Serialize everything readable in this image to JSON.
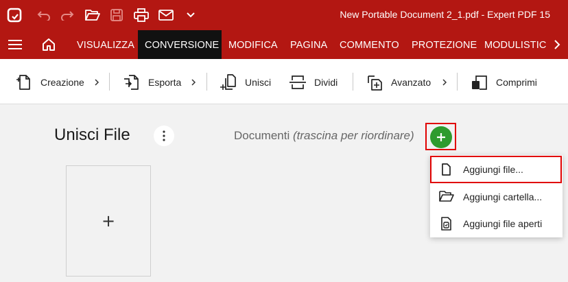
{
  "window": {
    "title": "New Portable Document 2_1.pdf   -   Expert PDF 15",
    "accent_color": "#b31712",
    "quick_icons": [
      "app-logo-icon",
      "undo-icon",
      "redo-icon",
      "open-folder-icon",
      "save-icon",
      "print-icon",
      "mail-icon",
      "chevron-down-icon"
    ]
  },
  "menu": {
    "tabs": [
      {
        "label": "VISUALIZZA",
        "active": false
      },
      {
        "label": "CONVERSIONE",
        "active": true
      },
      {
        "label": "MODIFICA",
        "active": false
      },
      {
        "label": "PAGINA",
        "active": false
      },
      {
        "label": "COMMENTO",
        "active": false
      },
      {
        "label": "PROTEZIONE",
        "active": false
      },
      {
        "label": "MODULISTIC",
        "active": false
      }
    ]
  },
  "toolbar": {
    "creazione": "Creazione",
    "esporta": "Esporta",
    "unisci": "Unisci",
    "dividi": "Dividi",
    "avanzato": "Avanzato",
    "comprimi": "Comprimi"
  },
  "content": {
    "title": "Unisci File",
    "docs_label": "Documenti",
    "docs_hint": "(trascina per riordinare)",
    "slot_symbol": "+",
    "add_button_color": "#2e9b2e"
  },
  "dropdown": {
    "items": [
      {
        "label": "Aggiungi file...",
        "icon": "file-icon"
      },
      {
        "label": "Aggiungi cartella...",
        "icon": "folder-open-icon"
      },
      {
        "label": "Aggiungi file aperti",
        "icon": "open-files-icon"
      }
    ]
  }
}
